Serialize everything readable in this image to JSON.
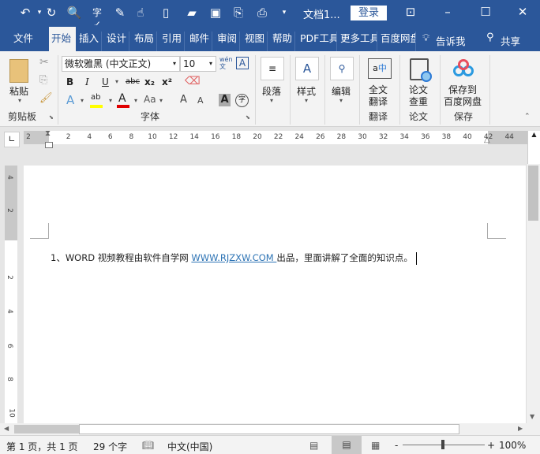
{
  "titlebar": {
    "doc_title": "文档1...",
    "login": "登录",
    "quick_access": [
      "undo-icon",
      "redo-icon",
      "print-preview-icon",
      "spellcheck-icon",
      "edit-icon",
      "touch-mode-icon",
      "new-doc-icon",
      "open-icon",
      "save-icon",
      "attach-icon",
      "print-icon",
      "customize-icon"
    ]
  },
  "tabs": [
    "文件",
    "开始",
    "插入",
    "设计",
    "布局",
    "引用",
    "邮件",
    "审阅",
    "视图",
    "帮助",
    "PDF工具",
    "更多工具",
    "百度网盘"
  ],
  "tell_me": "告诉我",
  "share": "共享",
  "ribbon": {
    "paste": "粘贴",
    "clipboard": "剪贴板",
    "font_name": "微软雅黑 (中文正文)",
    "font_size": "10",
    "font_group": "字体",
    "paragraph": "段落",
    "styles": "样式",
    "editing": "编辑",
    "translate_btn": [
      "全文",
      "翻译"
    ],
    "translate_group": "翻译",
    "paper_btn": [
      "论文",
      "查重"
    ],
    "paper_group": "论文",
    "save_btn": [
      "保存到",
      "百度网盘"
    ],
    "save_group": "保存",
    "fmt": {
      "bold": "B",
      "italic": "I",
      "underline": "U",
      "strike": "abc",
      "sub": "x₂",
      "sup": "x²",
      "effects": "A",
      "highlight": "ab",
      "fontcolor": "A",
      "case": "Aa",
      "grow": "A",
      "shrink": "A",
      "shade": "A",
      "enclose": "字",
      "phonetic": "wén文",
      "border": "A"
    },
    "colors": {
      "highlight": "#ffff00",
      "fontcolor": "#e00000"
    }
  },
  "ruler": {
    "labels": [
      "2",
      "2",
      "4",
      "6",
      "8",
      "10",
      "12",
      "14",
      "16",
      "18",
      "20",
      "22",
      "24",
      "26",
      "28",
      "30",
      "32",
      "34",
      "36",
      "38",
      "40",
      "42",
      "44"
    ],
    "vlabels": [
      "4",
      "2",
      "2",
      "4",
      "6",
      "8",
      "10"
    ]
  },
  "document": {
    "prefix": "1、WORD 视频教程由软件自学网 ",
    "link": "WWW.RJZXW.COM ",
    "suffix": "出品，里面讲解了全面的知识点。"
  },
  "status": {
    "page": "第 1 页，共 1 页",
    "words": "29 个字",
    "lang": "中文(中国)",
    "zoom": "100%",
    "zoom_value": 100
  }
}
